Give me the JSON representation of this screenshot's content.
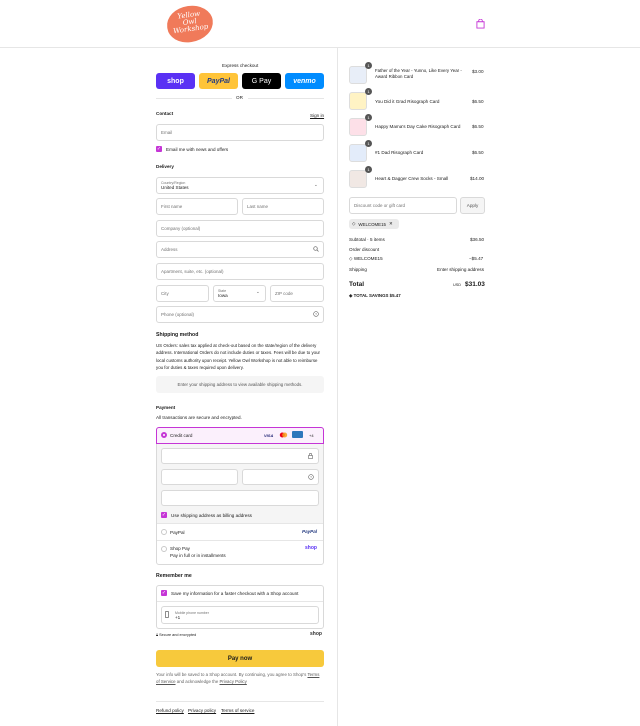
{
  "header": {
    "logo_text_1": "Yellow",
    "logo_text_2": "Owl",
    "logo_text_3": "Workshop"
  },
  "express": {
    "label": "Express checkout",
    "or": "OR",
    "shop": "shop",
    "paypal": "PayPal",
    "gpay": "G Pay",
    "venmo": "venmo"
  },
  "contact": {
    "title": "Contact",
    "sign_in": "Sign in",
    "email_placeholder": "Email",
    "news_label": "Email me with news and offers"
  },
  "delivery": {
    "title": "Delivery",
    "country_label": "Country/Region",
    "country_value": "United States",
    "first_name": "First name",
    "last_name": "Last name",
    "company": "Company (optional)",
    "address": "Address",
    "apartment": "Apartment, suite, etc. (optional)",
    "city": "City",
    "state_label": "State",
    "state_value": "Iowa",
    "zip": "ZIP code",
    "phone": "Phone (optional)"
  },
  "shipping": {
    "title": "Shipping method",
    "note": "US Orders: sales tax applied at check-out based on the state/region of the delivery address. International Orders do not include duties or taxes. Fees will be due to your local customs authority upon receipt. Yellow Owl Workshop is not able to reimburse you for duties & taxes required upon delivery.",
    "placeholder": "Enter your shipping address to view available shipping methods."
  },
  "payment": {
    "title": "Payment",
    "subtitle": "All transactions are secure and encrypted.",
    "credit_card": "Credit card",
    "more_cards": "+4",
    "billing_label": "Use shipping address as billing address",
    "paypal": "PayPal",
    "paypal_logo": "PayPal",
    "shop_pay": "Shop Pay",
    "shop_pay_sub": "Pay in full or in installments",
    "shop_logo": "shop"
  },
  "remember": {
    "title": "Remember me",
    "save_label": "Save my information for a faster checkout with a Shop account",
    "phone_label": "Mobile phone number",
    "phone_value": "+1",
    "secure": "Secure and encrypted",
    "shop": "shop"
  },
  "pay_button": "Pay now",
  "legal": {
    "pre": "Your info will be saved to a Shop account. By continuing, you agree to Shop's",
    "terms": "Terms of Service",
    "mid": "and acknowledge the",
    "privacy": "Privacy Policy"
  },
  "footer_links": [
    "Refund policy",
    "Privacy policy",
    "Terms of service"
  ],
  "order": {
    "items": [
      {
        "qty": "1",
        "name": "Father of the Year - Yunno, Like Every Year - Award Ribbon Card",
        "price": "$3.00"
      },
      {
        "qty": "1",
        "name": "You Did it Grad Risograph Card",
        "price": "$6.50"
      },
      {
        "qty": "1",
        "name": "Happy Mama's Day Cake Risograph Card",
        "price": "$6.50"
      },
      {
        "qty": "1",
        "name": "#1 Dad Risograph Card",
        "price": "$6.50"
      },
      {
        "qty": "1",
        "name": "Heart & Dagger Crew Socks - Small",
        "price": "$14.00"
      }
    ],
    "discount_placeholder": "Discount code or gift card",
    "apply": "Apply",
    "code_tag": "WELCOME15",
    "subtotal_label": "Subtotal · 5 items",
    "subtotal": "$36.50",
    "order_discount_label": "Order discount",
    "discount_code": "WELCOME15",
    "discount_value": "−$5.47",
    "shipping_label": "Shipping",
    "shipping_value": "Enter shipping address",
    "total_label": "Total",
    "currency": "USD",
    "total": "$31.03",
    "savings_label": "TOTAL SAVINGS",
    "savings": "$5.47"
  },
  "colors": {
    "accent": "#c535d6",
    "shop": "#5a31f4",
    "paypal": "#ffc439",
    "venmo": "#008cff",
    "pay": "#f7c93c",
    "logo": "#f07a5a"
  }
}
